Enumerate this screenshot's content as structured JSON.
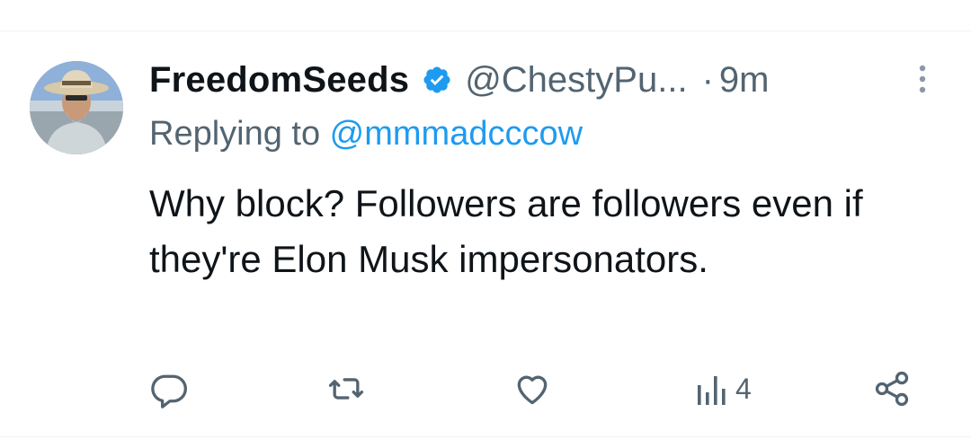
{
  "tweet": {
    "display_name": "FreedomSeeds",
    "handle": "@ChestyPu...",
    "separator": "·",
    "time": "9m",
    "replying_prefix": "Replying to ",
    "replying_to": "@mmmadcccow",
    "text": "Why block? Followers are followers even if they're Elon Musk impersonators.",
    "views": "4"
  },
  "colors": {
    "text_primary": "#0f1419",
    "text_secondary": "#536471",
    "accent": "#1d9bf0"
  },
  "icons": {
    "verified": "verified-badge-icon",
    "more": "more-vertical-icon",
    "reply": "reply-icon",
    "retweet": "retweet-icon",
    "like": "heart-icon",
    "views": "views-bar-chart-icon",
    "share": "share-icon"
  }
}
